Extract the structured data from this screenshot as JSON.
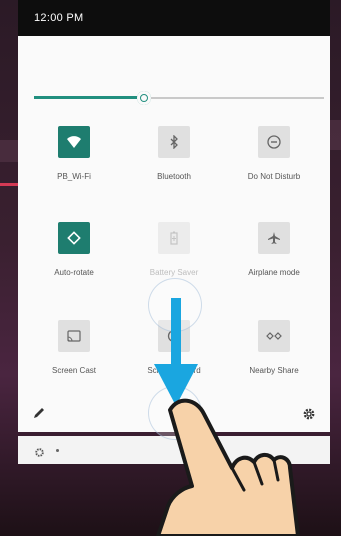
{
  "status_bar": {
    "time": "12:00 PM"
  },
  "brightness": {
    "level": 0.38
  },
  "tiles": [
    {
      "label": "PB_Wi-Fi",
      "icon": "wifi-icon",
      "active": true
    },
    {
      "label": "Bluetooth",
      "icon": "bluetooth-icon",
      "active": false
    },
    {
      "label": "Do Not Disturb",
      "icon": "do-not-disturb-icon",
      "active": false
    },
    {
      "label": "Auto-rotate",
      "icon": "auto-rotate-icon",
      "active": true
    },
    {
      "label": "Battery Saver",
      "icon": "battery-saver-icon",
      "active": false,
      "disabled": true
    },
    {
      "label": "Airplane mode",
      "icon": "airplane-icon",
      "active": false
    },
    {
      "label": "Screen Cast",
      "icon": "cast-icon",
      "active": false
    },
    {
      "label": "Screen Record",
      "icon": "screen-record-icon",
      "active": false
    },
    {
      "label": "Nearby Share",
      "icon": "nearby-share-icon",
      "active": false
    }
  ],
  "footer": {
    "edit_icon": "pencil-icon",
    "settings_icon": "gear-icon"
  },
  "mini_bar": {
    "settings_icon": "gear-icon"
  },
  "colors": {
    "accent": "#1e7d6f",
    "arrow": "#1aa6e0",
    "marker": "#d43a55",
    "hand_fill": "#f7d2a9"
  }
}
